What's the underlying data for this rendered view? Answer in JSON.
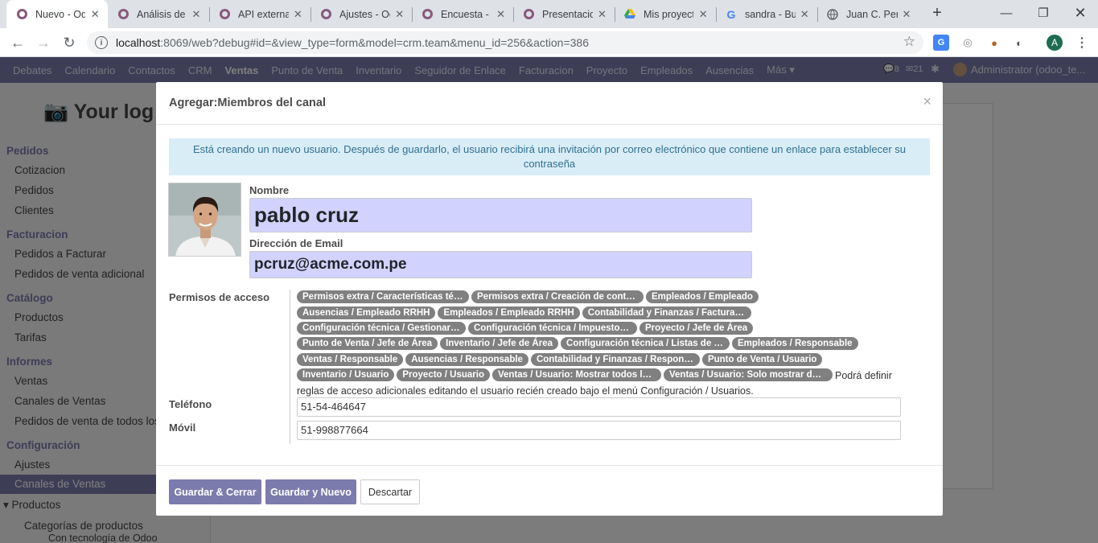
{
  "browser": {
    "tabs": [
      {
        "title": "Nuevo - Od",
        "icon": "odoo-icon",
        "active": true
      },
      {
        "title": "Análisis de",
        "icon": "odoo-icon",
        "active": false
      },
      {
        "title": "API externa",
        "icon": "odoo-icon",
        "active": false
      },
      {
        "title": "Ajustes - Od",
        "icon": "odoo-icon",
        "active": false
      },
      {
        "title": "Encuesta - (",
        "icon": "odoo-icon",
        "active": false
      },
      {
        "title": "Presentacio",
        "icon": "odoo-icon",
        "active": false
      },
      {
        "title": "Mis proyect",
        "icon": "drive-icon",
        "active": false
      },
      {
        "title": "sandra - Bu",
        "icon": "google-icon",
        "active": false
      },
      {
        "title": "Juan C. Pere",
        "icon": "globe-icon",
        "active": false
      }
    ],
    "new_tab": "+",
    "url_host": "localhost",
    "url_rest": ":8069/web?debug#id=&view_type=form&model=crm.team&menu_id=256&action=386",
    "profile_initial": "A"
  },
  "odoo": {
    "menu": [
      "Debates",
      "Calendario",
      "Contactos",
      "CRM",
      "Ventas",
      "Punto de Venta",
      "Inventario",
      "Seguidor de Enlace",
      "Facturacion",
      "Proyecto",
      "Empleados",
      "Ausencias",
      "Más"
    ],
    "active_menu": "Ventas",
    "counter_1": "8",
    "counter_2": "21",
    "user": "Administrator (odoo_te...",
    "company_logo_text": "Your log",
    "sidebar": {
      "sections": [
        {
          "title": "Pedidos",
          "items": [
            "Cotizacion",
            "Pedidos",
            "Clientes"
          ]
        },
        {
          "title": "Facturacion",
          "items": [
            "Pedidos a Facturar",
            "Pedidos de venta adicional"
          ]
        },
        {
          "title": "Catálogo",
          "items": [
            "Productos",
            "Tarifas"
          ]
        },
        {
          "title": "Informes",
          "items": [
            "Ventas",
            "Canales de Ventas",
            "Pedidos de venta de todos los"
          ]
        },
        {
          "title": "Configuración",
          "items": [
            "Ajustes",
            "Canales de Ventas"
          ]
        }
      ],
      "active_item": "Canales de Ventas",
      "submenu_title": "Productos",
      "submenu_items": [
        "Categorías de productos"
      ],
      "powered_by": "Con tecnología de Odoo"
    }
  },
  "modal": {
    "title": "Agregar:Miembros del canal",
    "close": "×",
    "alert": "Está creando un nuevo usuario. Después de guardarlo, el usuario recibirá una invitación por correo electrónico que contiene un enlace para establecer su contraseña",
    "name_label": "Nombre",
    "name_value": "pablo cruz",
    "email_label": "Dirección de Email",
    "email_value": "pcruz@acme.com.pe",
    "permisos_label": "Permisos de acceso",
    "permisos": [
      "Permisos extra / Características técnicas",
      "Permisos extra / Creación de contactos",
      "Empleados / Empleado",
      "Ausencias / Empleado RRHH",
      "Empleados / Empleado RRHH",
      "Contabilidad y Finanzas / Facturación",
      "Configuración técnica / Gestionar empaquetado",
      "Configuración técnica / Impuesto B...",
      "Proyecto / Jefe de Área",
      "Punto de Venta / Jefe de Área",
      "Inventario / Jefe de Área",
      "Configuración técnica / Listas de precios",
      "Empleados / Responsable",
      "Ventas / Responsable",
      "Ausencias / Responsable",
      "Contabilidad y Finanzas / Responsable",
      "Punto de Venta / Usuario",
      "Inventario / Usuario",
      "Proyecto / Usuario",
      "Ventas / Usuario: Mostrar todos los documentos",
      "Ventas / Usuario: Solo mostrar documentos propios"
    ],
    "permisos_note": "Podrá definir reglas de acceso adicionales editando el usuario recién creado bajo el menú Configuración / Usuarios.",
    "phone_label": "Teléfono",
    "phone_value": "51-54-464647",
    "mobile_label": "Móvil",
    "mobile_value": "51-998877664",
    "btn_save_close": "Guardar & Cerrar",
    "btn_save_new": "Guardar y Nuevo",
    "btn_discard": "Descartar"
  },
  "colors": {
    "odoo_purple": "#7c7bad",
    "tag_gray": "#808080",
    "input_highlight": "#d2d2ff",
    "alert_bg": "#d9edf7"
  }
}
